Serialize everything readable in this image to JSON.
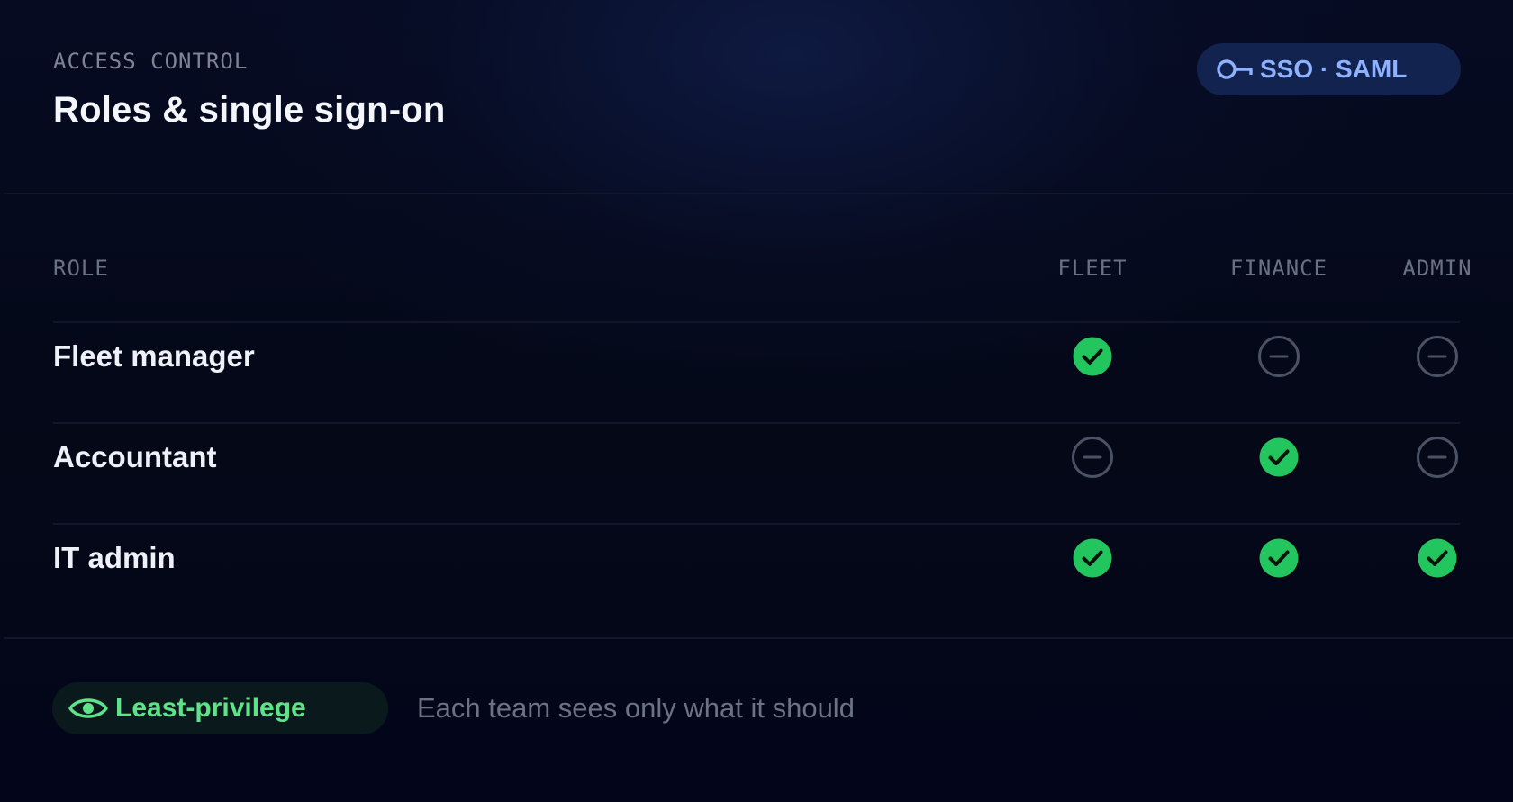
{
  "header": {
    "eyebrow": "ACCESS CONTROL",
    "title": "Roles & single sign-on"
  },
  "sso_badge": {
    "icon": "key-icon",
    "label": "SSO · SAML"
  },
  "table": {
    "columns": [
      "ROLE",
      "FLEET",
      "FINANCE",
      "ADMIN"
    ],
    "rows": [
      {
        "role": "Fleet manager",
        "access": [
          "granted",
          "none",
          "none"
        ]
      },
      {
        "role": "Accountant",
        "access": [
          "none",
          "granted",
          "none"
        ]
      },
      {
        "role": "IT admin",
        "access": [
          "granted",
          "granted",
          "granted"
        ]
      }
    ]
  },
  "footer": {
    "badge_icon": "eye-icon",
    "badge_label": "Least-privilege",
    "note": "Each team sees only what it should"
  },
  "colors": {
    "accent_blue": "#8eb2ff",
    "granted_green": "#22c55e",
    "badge_green": "#5fe389",
    "none_gray": "#4a5264"
  }
}
